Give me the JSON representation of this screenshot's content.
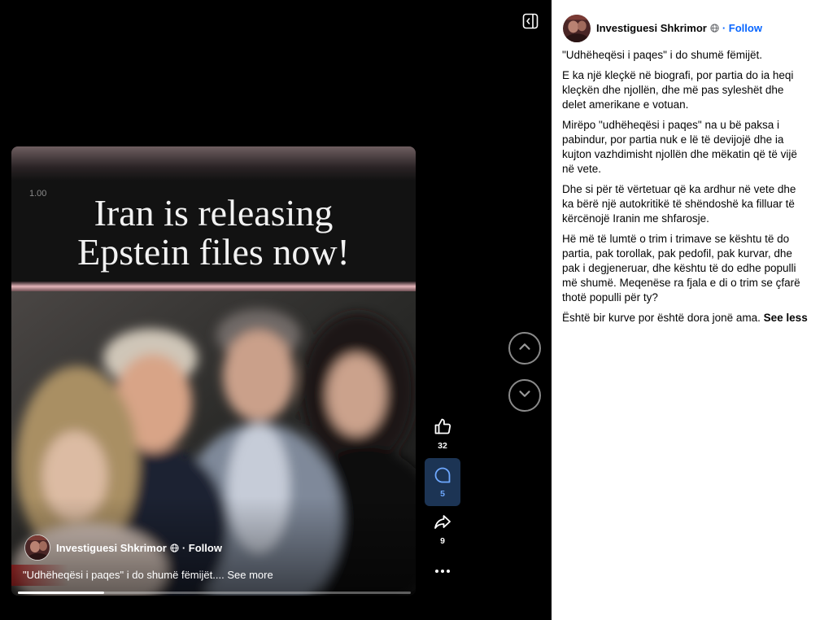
{
  "viewer": {
    "toggle_icon": "sidebar-toggle-icon",
    "prev_icon": "chevron-up-icon",
    "next_icon": "chevron-down-icon"
  },
  "video": {
    "speed_label": "1.00",
    "headline": [
      "Iran is releasing",
      "Epstein files now!"
    ],
    "author_name": "Investiguesi Shkrimor",
    "privacy_icon": "globe-icon",
    "follow_label": "· Follow",
    "caption": "\"Udhëheqësi i paqes\" i do shumë fëmijët....",
    "see_more": "See more",
    "progress": 0.22
  },
  "actions": {
    "like": {
      "icon": "thumbs-up-icon",
      "count": "32"
    },
    "comment": {
      "icon": "comment-icon",
      "count": "5",
      "selected": true
    },
    "share": {
      "icon": "share-icon",
      "count": "9"
    },
    "more": {
      "icon": "more-options-icon"
    }
  },
  "post": {
    "author_name": "Investiguesi Shkrimor",
    "privacy_icon": "globe-icon",
    "follow_label": "· Follow",
    "paragraphs": [
      "\"Udhëheqësi i paqes\" i do shumë fëmijët.",
      "E ka një kleçkë në biografi, por partia do ia heqi kleçkën dhe njollën, dhe më pas syleshët dhe delet amerikane e votuan.",
      "Mirëpo \"udhëheqësi i paqes\" na u bë paksa i pabindur, por partia nuk e lë të devijojë dhe ia kujton vazhdimisht njollën dhe mëkatin që të vijë në vete.",
      "Dhe si për të vërtetuar që ka ardhur në vete dhe ka bërë një autokritikë të shëndoshë ka filluar të kërcënojë Iranin me shfarosje.",
      "Hë më të lumtë o trim i trimave se kështu të do partia, pak torollak, pak pedofil, pak kurvar, dhe pak i degjeneruar, dhe kështu të do edhe populli më shumë. Meqenëse ra fjala e di o trim se çfarë thotë populli për ty?"
    ],
    "last_line": "Është bir kurve por është dora jonë ama.",
    "see_less": "See less"
  },
  "colors": {
    "viewer_background": "#000000",
    "panel_background": "#ffffff",
    "text": "#050505",
    "follow_link": "#0866ff",
    "comment_active_bg": "#1c3454",
    "comment_active_fg": "#6ea8ff"
  }
}
